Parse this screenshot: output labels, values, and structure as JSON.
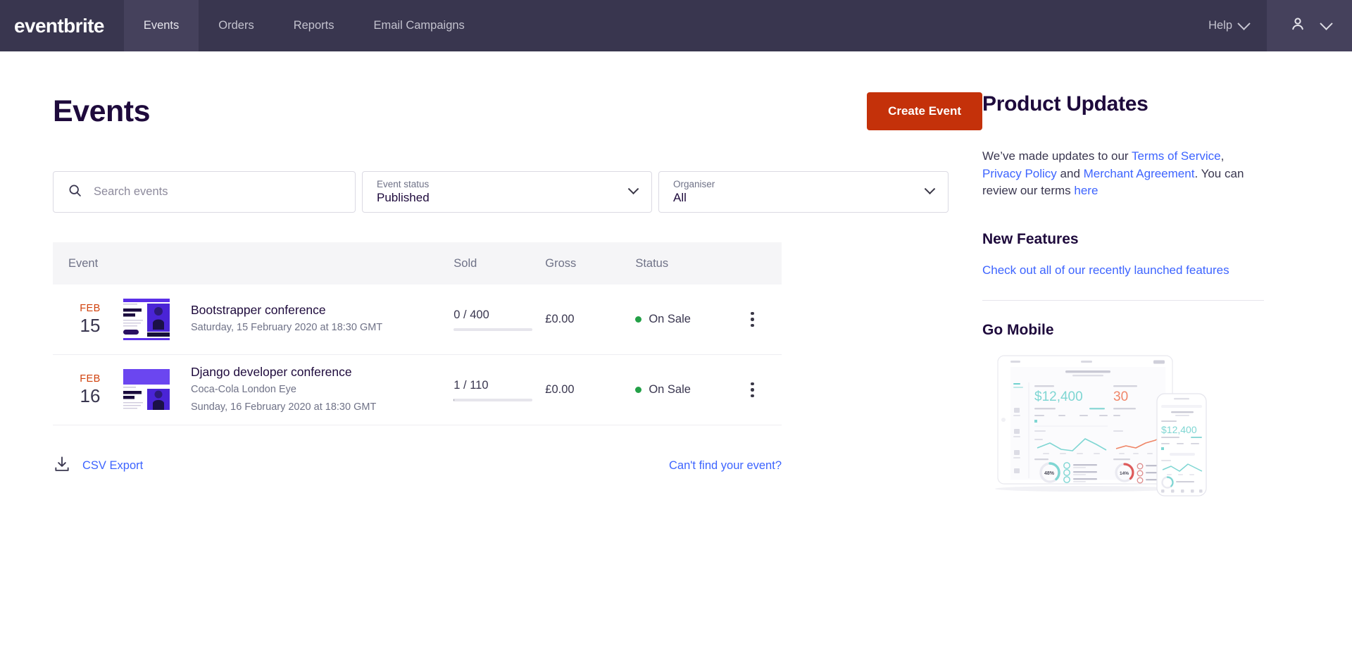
{
  "topnav": {
    "brand": "eventbrite",
    "items": [
      {
        "label": "Events",
        "active": true
      },
      {
        "label": "Orders",
        "active": false
      },
      {
        "label": "Reports",
        "active": false
      },
      {
        "label": "Email Campaigns",
        "active": false
      }
    ],
    "help_label": "Help",
    "account_icon": "user-icon",
    "background_color": "#39364f",
    "active_background_color": "#45415c"
  },
  "header": {
    "title": "Events",
    "create_event_label": "Create Event",
    "create_event_color": "#c4310a"
  },
  "filters": {
    "search": {
      "icon": "search-icon",
      "placeholder": "Search events",
      "value": ""
    },
    "event_status": {
      "label": "Event status",
      "value": "Published",
      "chevron": "chevron-down-icon"
    },
    "organiser": {
      "label": "Organiser",
      "value": "All",
      "chevron": "chevron-down-icon"
    }
  },
  "table": {
    "columns": {
      "event": "Event",
      "sold": "Sold",
      "gross": "Gross",
      "status": "Status"
    },
    "rows": [
      {
        "month": "FEB",
        "day": "15",
        "title": "Bootstrapper conference",
        "venue": "",
        "datetime": "Saturday, 15 February 2020 at 18:30 GMT",
        "sold": "0 / 400",
        "sold_percent": 0,
        "gross": "£0.00",
        "status": "On Sale",
        "status_color": "#23a047",
        "menu_icon": "kebab-menu-icon"
      },
      {
        "month": "FEB",
        "day": "16",
        "title": "Django developer conference",
        "venue": "Coca-Cola London Eye",
        "datetime": "Sunday, 16 February 2020 at 18:30 GMT",
        "sold": "1 / 110",
        "sold_percent": 1,
        "gross": "£0.00",
        "status": "On Sale",
        "status_color": "#23a047",
        "menu_icon": "kebab-menu-icon"
      }
    ]
  },
  "footer": {
    "csv_export_label": "CSV Export",
    "csv_icon": "download-icon",
    "cant_find_label": "Can't find your event?"
  },
  "sidebar": {
    "product_updates_title": "Product Updates",
    "body": {
      "part1": "We’ve made updates to our ",
      "link1": "Terms of Service",
      "part2": ", ",
      "link2": "Privacy Policy",
      "part3": " and ",
      "link3": "Merchant Agreement",
      "part4": ". You can review our terms ",
      "link4": "here"
    },
    "new_features_title": "New Features",
    "new_features_link": "Check out all of our recently launched features",
    "go_mobile_title": "Go Mobile",
    "go_mobile_image": "tablet-and-phone-dashboard-illustration"
  }
}
